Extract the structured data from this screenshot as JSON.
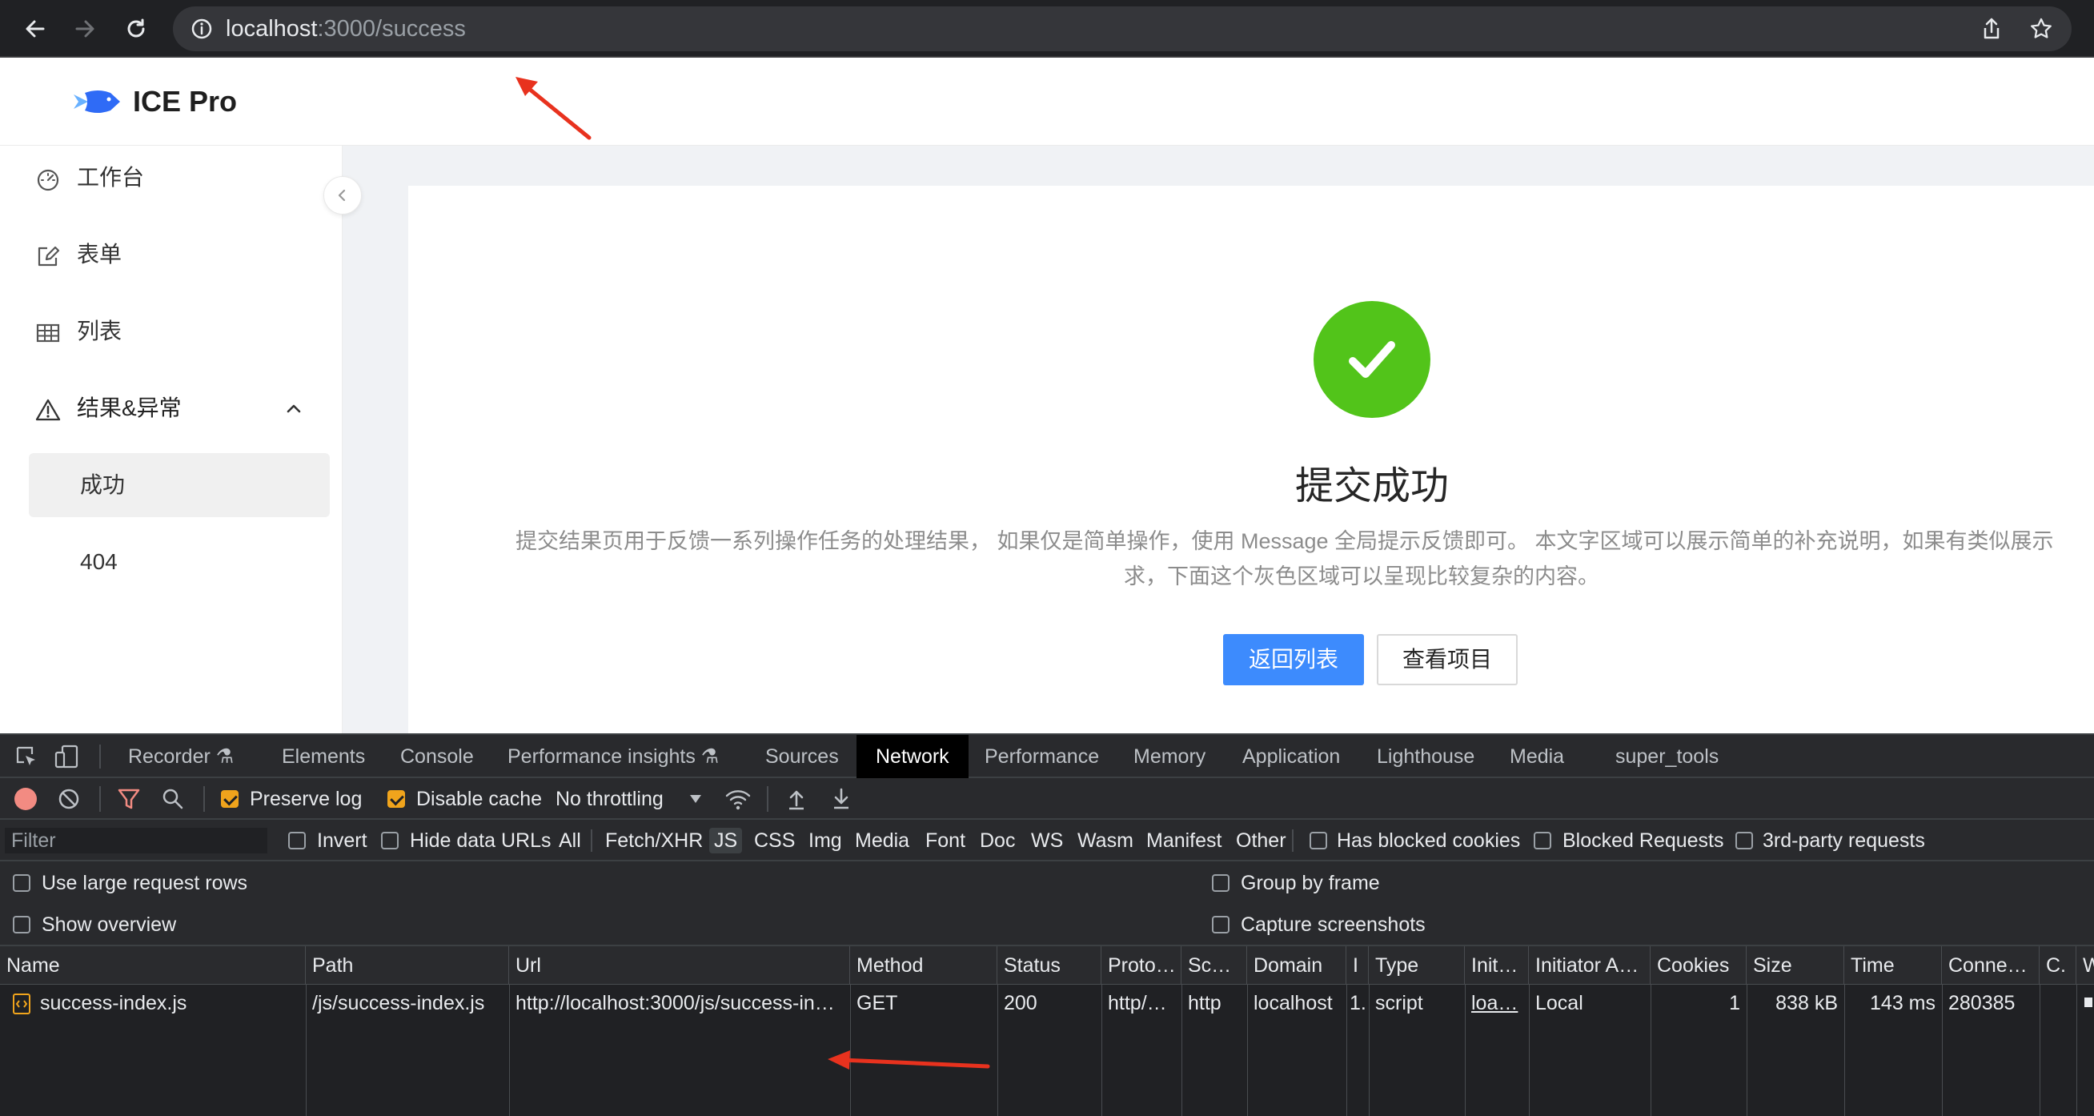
{
  "browser": {
    "url_host": "localhost",
    "url_rest": ":3000/success"
  },
  "app": {
    "logo_text": "ICE Pro",
    "sidebar": {
      "items": [
        {
          "label": "工作台",
          "icon": "dashboard-icon"
        },
        {
          "label": "表单",
          "icon": "edit-form-icon"
        },
        {
          "label": "列表",
          "icon": "table-icon"
        },
        {
          "label": "结果&异常",
          "icon": "warning-icon",
          "expanded": true
        }
      ],
      "sub_items": [
        {
          "label": "成功",
          "active": true
        },
        {
          "label": "404",
          "active": false
        }
      ]
    },
    "result": {
      "title": "提交成功",
      "desc_line1": "提交结果页用于反馈一系列操作任务的处理结果， 如果仅是简单操作，使用 Message 全局提示反馈即可。 本文字区域可以展示简单的补充说明，如果有类似展示",
      "desc_line2": "求，下面这个灰色区域可以呈现比较复杂的内容。",
      "primary_button": "返回列表",
      "secondary_button": "查看项目"
    },
    "colors": {
      "success": "#52c41a",
      "primary": "#3d8bfd",
      "arrow": "#e8321e"
    }
  },
  "devtools": {
    "tabs": [
      "Recorder",
      "Elements",
      "Console",
      "Performance insights",
      "Sources",
      "Network",
      "Performance",
      "Memory",
      "Application",
      "Lighthouse",
      "Media",
      "super_tools"
    ],
    "active_tab": "Network",
    "toolbar": {
      "preserve_log": "Preserve log",
      "disable_cache": "Disable cache",
      "throttling": "No throttling"
    },
    "filter": {
      "placeholder": "Filter",
      "invert": "Invert",
      "hide_data_urls": "Hide data URLs",
      "types": [
        "All",
        "Fetch/XHR",
        "JS",
        "CSS",
        "Img",
        "Media",
        "Font",
        "Doc",
        "WS",
        "Wasm",
        "Manifest",
        "Other"
      ],
      "active_type": "JS",
      "has_blocked_cookies": "Has blocked cookies",
      "blocked_requests": "Blocked Requests",
      "third_party": "3rd-party requests"
    },
    "options": {
      "large_rows": "Use large request rows",
      "show_overview": "Show overview",
      "group_by_frame": "Group by frame",
      "capture_screenshots": "Capture screenshots"
    },
    "table": {
      "headers": [
        "Name",
        "Path",
        "Url",
        "Method",
        "Status",
        "Proto…",
        "Sc…",
        "Domain",
        "I",
        "Type",
        "Init…",
        "Initiator A…",
        "Cookies",
        "Size",
        "Time",
        "Conne…",
        "C.",
        "W"
      ],
      "row": {
        "name": "success-index.js",
        "path": "/js/success-index.js",
        "url": "http://localhost:3000/js/success-in…",
        "method": "GET",
        "status": "200",
        "protocol": "http/…",
        "scheme": "http",
        "domain": "localhost",
        "i": "1.",
        "type": "script",
        "initiator": "loa…",
        "initiator_address": "Local",
        "cookies": "1",
        "size": "838 kB",
        "time": "143 ms",
        "connection": "280385"
      }
    }
  }
}
